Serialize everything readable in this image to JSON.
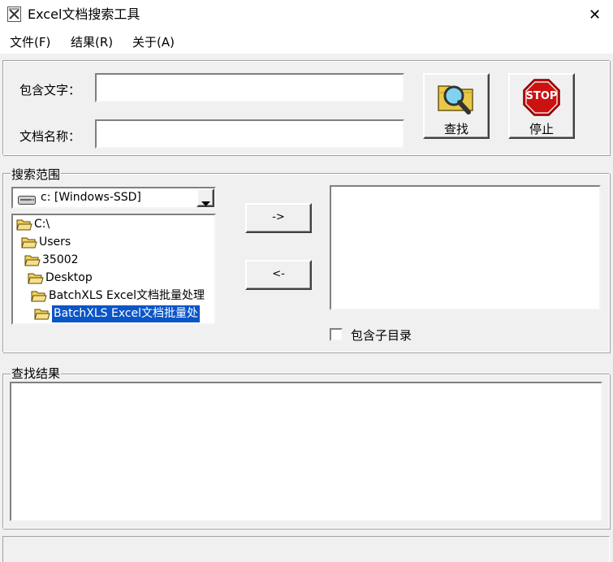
{
  "window": {
    "title": "Excel文档搜索工具",
    "close_glyph": "✕"
  },
  "menu": [
    {
      "label": "文件(F)"
    },
    {
      "label": "结果(R)"
    },
    {
      "label": "关于(A)"
    }
  ],
  "search_form": {
    "contains_text_label": "包含文字：",
    "contains_text_value": "",
    "file_name_label": "文档名称：",
    "file_name_value": ""
  },
  "toolbar": {
    "find_label": "查找",
    "find_icon": "magnifier-folder-icon",
    "stop_label": "停止",
    "stop_sign_text": "STOP"
  },
  "scope": {
    "group_label": "搜索范围",
    "drive_selected": "c: [Windows-SSD]",
    "tree": [
      {
        "label": "C:\\",
        "selected": false
      },
      {
        "label": "Users",
        "selected": false
      },
      {
        "label": "35002",
        "selected": false
      },
      {
        "label": "Desktop",
        "selected": false
      },
      {
        "label": "BatchXLS Excel文档批量处理",
        "selected": false
      },
      {
        "label": "BatchXLS Excel文档批量处",
        "selected": true
      }
    ],
    "add_button": "->",
    "remove_button": "<-",
    "include_subdirs_label": "包含子目录",
    "include_subdirs_checked": false
  },
  "results": {
    "group_label": "查找结果"
  },
  "colors": {
    "selection": "#0a55c8",
    "stop_red": "#cc1111",
    "folder_yellow": "#f2d15a"
  }
}
